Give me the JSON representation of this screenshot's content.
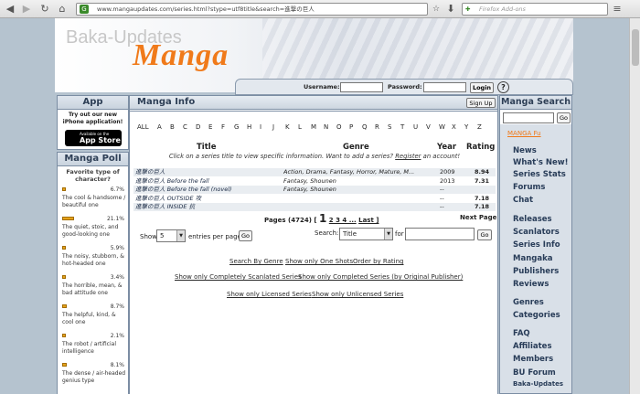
{
  "browser": {
    "url": "www.mangaupdates.com/series.html?stype=utf8title&search=進撃の巨人",
    "search_placeholder": "Firefox Add-ons"
  },
  "banner": {
    "logo_small": "Baka-Updates",
    "logo_big": "Manga"
  },
  "login": {
    "username_label": "Username:",
    "password_label": "Password:",
    "login_button": "Login",
    "help": "?",
    "signup_button": "Sign Up"
  },
  "app": {
    "title": "App",
    "text": "Try out our new iPhone application!",
    "badge_small": "Available on the",
    "badge_big": "App Store"
  },
  "poll": {
    "title": "Manga Poll",
    "question": "Favorite type of character?",
    "options": [
      {
        "pct": "6.7%",
        "label": "The cool & handsome / beautiful one",
        "fill": 0.067
      },
      {
        "pct": "21.1%",
        "label": "The quiet, stoic, and good-looking one",
        "fill": 0.211
      },
      {
        "pct": "5.9%",
        "label": "The noisy, stubborn, & hot-headed one",
        "fill": 0.059
      },
      {
        "pct": "3.4%",
        "label": "The horrible, mean, & bad attitude one",
        "fill": 0.034
      },
      {
        "pct": "8.7%",
        "label": "The helpful, kind, & cool one",
        "fill": 0.087
      },
      {
        "pct": "2.1%",
        "label": "The robot / artificial intelligence",
        "fill": 0.021
      },
      {
        "pct": "8.1%",
        "label": "The dense / air-headed genius type",
        "fill": 0.081
      }
    ]
  },
  "main": {
    "title": "Manga Info",
    "alphabet": [
      "ALL",
      "A",
      "B",
      "C",
      "D",
      "E",
      "F",
      "G",
      "H",
      "I",
      "J",
      "K",
      "L",
      "M",
      "N",
      "O",
      "P",
      "Q",
      "R",
      "S",
      "T",
      "U",
      "V",
      "W",
      "X",
      "Y",
      "Z"
    ],
    "headers": {
      "title": "Title",
      "genre": "Genre",
      "year": "Year",
      "rating": "Rating"
    },
    "subtitle_pre": "Click on a series title to view specific information. Want to add a series?",
    "subtitle_link": "Register",
    "subtitle_post": "an account!",
    "rows": [
      {
        "title": "進撃の巨人",
        "genre": "Action, Drama, Fantasy, Horror, Mature, M...",
        "year": "2009",
        "rating": "8.94"
      },
      {
        "title": "進撃の巨人 Before the fall",
        "genre": "Fantasy, Shounen",
        "year": "2013",
        "rating": "7.31"
      },
      {
        "title": "進撃の巨人 Before the fall (novel)",
        "genre": "Fantasy, Shounen",
        "year": "--",
        "rating": ""
      },
      {
        "title": "進撃の巨人 OUTSIDE 攻",
        "genre": "",
        "year": "--",
        "rating": "7.18"
      },
      {
        "title": "進撃の巨人 INSIDE 抗",
        "genre": "",
        "year": "--",
        "rating": "7.18"
      }
    ],
    "pages_label": "Pages (4724) [",
    "page_current": "1",
    "page_links": "2 3 4 ...",
    "page_last": "Last ]",
    "next_page": "Next Page",
    "show_label": "Show",
    "show_value": "5",
    "entries_label": "entries per page",
    "go": "Go",
    "search_label": "Search:",
    "search_type": "Title",
    "for_label": "for",
    "links": [
      "Search By Genre",
      "Show only One Shots",
      "Order by Rating",
      "Show only Completely Scanlated Series",
      "Show only Completed Series (by Original Publisher)",
      "Show only Licensed Series",
      "Show only Unlicensed Series"
    ]
  },
  "right": {
    "title": "Manga Search",
    "go": "Go",
    "fu": "MANGA Fu",
    "nav": [
      "News",
      "What's New!",
      "Series Stats",
      "Forums",
      "Chat",
      "Releases",
      "Scanlators",
      "Series Info",
      "Mangaka",
      "Publishers",
      "Reviews",
      "Genres",
      "Categories",
      "FAQ",
      "Affiliates",
      "Members",
      "BU Forum",
      "Baka-Updates"
    ]
  }
}
